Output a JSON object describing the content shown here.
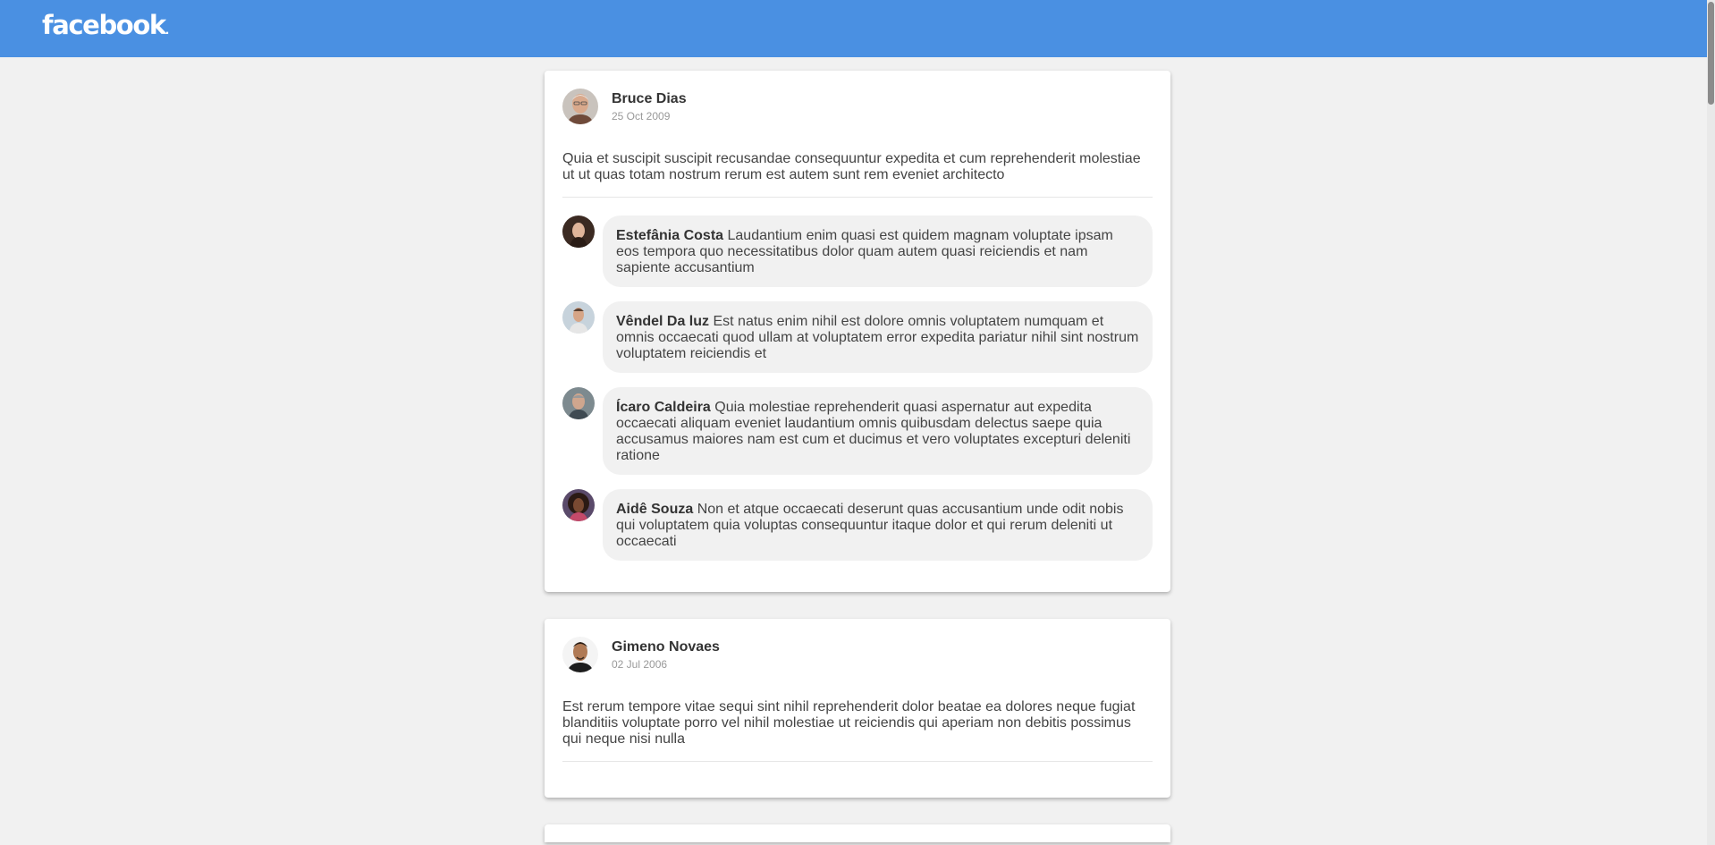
{
  "app": {
    "logo": "facebook",
    "brand_color": "#4a90e2"
  },
  "posts": [
    {
      "author": "Bruce Dias",
      "date": "25 Oct 2009",
      "avatar_icon": "avatar-photo",
      "body": "Quia et suscipit suscipit recusandae consequuntur expedita et cum reprehenderit molestiae ut ut quas totam nostrum rerum est autem sunt rem eveniet architecto",
      "comments": [
        {
          "author": "Estefânia Costa",
          "text": "Laudantium enim quasi est quidem magnam voluptate ipsam eos tempora quo necessitatibus dolor quam autem quasi reiciendis et nam sapiente accusantium"
        },
        {
          "author": "Vêndel Da luz",
          "text": "Est natus enim nihil est dolore omnis voluptatem numquam et omnis occaecati quod ullam at voluptatem error expedita pariatur nihil sint nostrum voluptatem reiciendis et"
        },
        {
          "author": "Ícaro Caldeira",
          "text": "Quia molestiae reprehenderit quasi aspernatur aut expedita occaecati aliquam eveniet laudantium omnis quibusdam delectus saepe quia accusamus maiores nam est cum et ducimus et vero voluptates excepturi deleniti ratione"
        },
        {
          "author": "Aidê Souza",
          "text": "Non et atque occaecati deserunt quas accusantium unde odit nobis qui voluptatem quia voluptas consequuntur itaque dolor et qui rerum deleniti ut occaecati"
        }
      ]
    },
    {
      "author": "Gimeno Novaes",
      "date": "02 Jul 2006",
      "avatar_icon": "avatar-photo",
      "body": "Est rerum tempore vitae sequi sint nihil reprehenderit dolor beatae ea dolores neque fugiat blanditiis voluptate porro vel nihil molestiae ut reiciendis qui aperiam non debitis possimus qui neque nisi nulla",
      "comments": []
    }
  ]
}
